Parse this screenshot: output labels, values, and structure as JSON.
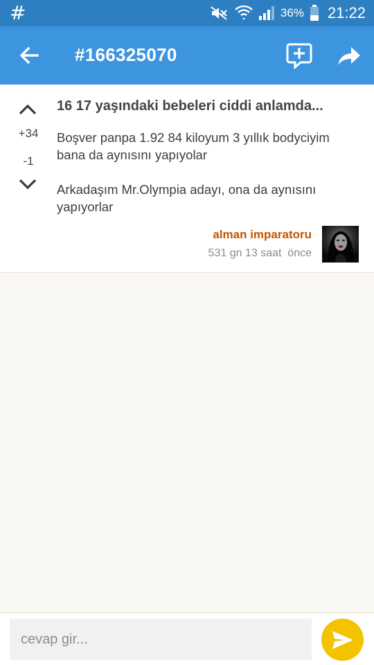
{
  "status_bar": {
    "left_glyph": "#",
    "battery": "36%",
    "time": "21:22",
    "icons": [
      "mute-icon",
      "wifi-icon",
      "signal-icon",
      "battery-icon"
    ]
  },
  "app_bar": {
    "title": "#166325070",
    "icons": [
      "back-arrow-icon",
      "add-comment-icon",
      "share-icon"
    ]
  },
  "entry": {
    "heading": "16 17 yaşındaki bebeleri ciddi anlamda...",
    "upvotes": "+34",
    "downvotes": "-1",
    "body": [
      "Boşver panpa 1.92 84 kiloyum 3 yıllık bodyciyim bana da aynısını yapıyolar",
      "Arkadaşım Mr.Olympia adayı, ona da aynısını yapıyorlar"
    ],
    "author": "alman imparatoru",
    "timestamp": "531 gn 13 saat  önce"
  },
  "reply": {
    "placeholder": "cevap gir...",
    "value": ""
  },
  "colors": {
    "status_bar": "#2e7fc1",
    "app_bar": "#3c95de",
    "author": "#c25500",
    "send_button": "#f3c300",
    "background": "#faf8f2"
  }
}
